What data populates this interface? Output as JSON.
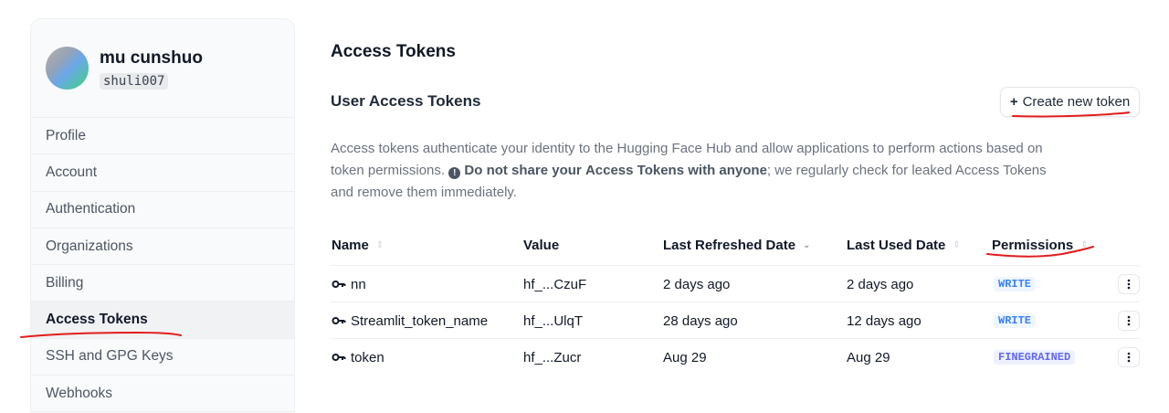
{
  "user": {
    "name": "mu cunshuo",
    "handle": "shuli007"
  },
  "sidebar": {
    "items": [
      {
        "label": "Profile",
        "active": false
      },
      {
        "label": "Account",
        "active": false
      },
      {
        "label": "Authentication",
        "active": false
      },
      {
        "label": "Organizations",
        "active": false
      },
      {
        "label": "Billing",
        "active": false
      },
      {
        "label": "Access Tokens",
        "active": true
      },
      {
        "label": "SSH and GPG Keys",
        "active": false
      },
      {
        "label": "Webhooks",
        "active": false
      }
    ]
  },
  "main": {
    "title": "Access Tokens",
    "section_title": "User Access Tokens",
    "create_button": {
      "plus": "+",
      "label": "Create new token"
    },
    "description": {
      "part1": "Access tokens authenticate your identity to the Hugging Face Hub and allow applications to perform actions based on token permissions.",
      "warning_icon": "!",
      "bold1": "Do not share your",
      "bold2": "Access Tokens",
      "bold3": "with anyone",
      "part2": "; we regularly check for leaked Access Tokens and remove them immediately."
    },
    "table": {
      "headers": {
        "name": "Name",
        "value": "Value",
        "last_refreshed": "Last Refreshed Date",
        "last_used": "Last Used Date",
        "permissions": "Permissions"
      },
      "rows": [
        {
          "name": "nn",
          "value": "hf_...CzuF",
          "last_refreshed": "2 days ago",
          "last_used": "2 days ago",
          "permission": "WRITE"
        },
        {
          "name": "Streamlit_token_name",
          "value": "hf_...UlqT",
          "last_refreshed": "28 days ago",
          "last_used": "12 days ago",
          "permission": "WRITE"
        },
        {
          "name": "token",
          "value": "hf_...Zucr",
          "last_refreshed": "Aug 29",
          "last_used": "Aug 29",
          "permission": "FINEGRAINED"
        }
      ]
    }
  },
  "icons": {
    "key": "key-icon",
    "menu": "vertical-dots-icon",
    "sort": "sort-icon"
  },
  "colors": {
    "annotation": "#e11d1d",
    "write_badge": "#3b82f6",
    "finegrained_badge": "#6366f1"
  }
}
